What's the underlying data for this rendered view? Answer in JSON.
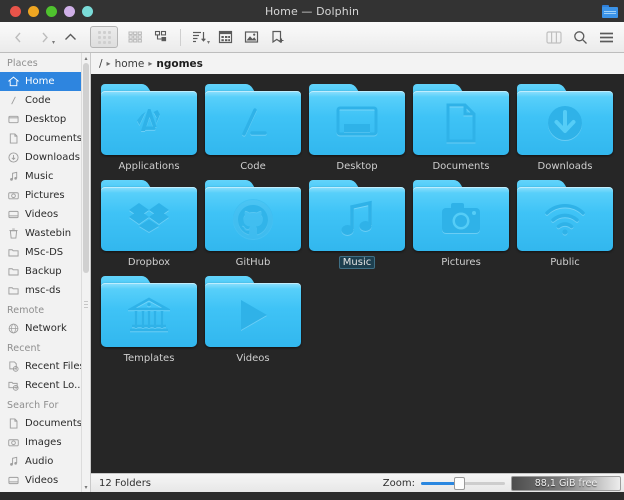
{
  "window": {
    "title": "Home — Dolphin",
    "traffic_lights": [
      "red",
      "yellow",
      "green",
      "purple",
      "cyan"
    ],
    "title_icon": "folder-icon"
  },
  "toolbar": {
    "items": [
      {
        "name": "back-button",
        "icon": "chevron-left-icon",
        "enabled": false
      },
      {
        "name": "forward-button",
        "icon": "chevron-right-icon",
        "enabled": false
      },
      {
        "name": "up-button",
        "icon": "chevron-up-icon",
        "enabled": true
      },
      {
        "name": "icons-view-button",
        "icon": "grid-view-icon",
        "enabled": true
      },
      {
        "name": "compact-view-button",
        "icon": "compact-view-icon",
        "enabled": true
      },
      {
        "name": "details-view-button",
        "icon": "details-view-icon",
        "enabled": true
      },
      {
        "name": "sort-button",
        "icon": "sort-icon",
        "enabled": true
      },
      {
        "name": "additional-info-button",
        "icon": "table-icon",
        "enabled": true
      },
      {
        "name": "preview-button",
        "icon": "image-preview-icon",
        "enabled": true
      },
      {
        "name": "split-new-button",
        "icon": "new-tab-icon",
        "enabled": true
      }
    ],
    "right_items": [
      {
        "name": "split-view-button",
        "icon": "split-panel-icon"
      },
      {
        "name": "search-button",
        "icon": "search-icon"
      },
      {
        "name": "menu-button",
        "icon": "hamburger-menu-icon"
      }
    ]
  },
  "sidebar": {
    "groups": [
      {
        "title": "Places",
        "items": [
          {
            "label": "Home",
            "icon": "home-icon",
            "active": true
          },
          {
            "label": "Code",
            "icon": "slash-icon",
            "active": false
          },
          {
            "label": "Desktop",
            "icon": "desktop-icon",
            "active": false
          },
          {
            "label": "Documents",
            "icon": "document-icon",
            "active": false
          },
          {
            "label": "Downloads",
            "icon": "download-icon",
            "active": false
          },
          {
            "label": "Music",
            "icon": "music-note-icon",
            "active": false
          },
          {
            "label": "Pictures",
            "icon": "camera-icon",
            "active": false
          },
          {
            "label": "Videos",
            "icon": "video-icon",
            "active": false
          },
          {
            "label": "Wastebin",
            "icon": "trash-icon",
            "active": false
          },
          {
            "label": "MSc-DS",
            "icon": "folder-icon",
            "active": false
          },
          {
            "label": "Backup",
            "icon": "folder-icon",
            "active": false
          },
          {
            "label": "msc-ds",
            "icon": "folder-icon",
            "active": false
          }
        ]
      },
      {
        "title": "Remote",
        "items": [
          {
            "label": "Network",
            "icon": "network-icon",
            "active": false
          }
        ]
      },
      {
        "title": "Recent",
        "items": [
          {
            "label": "Recent Files",
            "icon": "recent-file-icon",
            "active": false
          },
          {
            "label": "Recent Lo...",
            "icon": "recent-folder-icon",
            "active": false
          }
        ]
      },
      {
        "title": "Search For",
        "items": [
          {
            "label": "Documents",
            "icon": "document-icon",
            "active": false
          },
          {
            "label": "Images",
            "icon": "camera-icon",
            "active": false
          },
          {
            "label": "Audio",
            "icon": "music-note-icon",
            "active": false
          },
          {
            "label": "Videos",
            "icon": "video-icon",
            "active": false
          }
        ]
      }
    ]
  },
  "breadcrumb": {
    "root": "/",
    "separator": "▸",
    "parts": [
      "home",
      "ngomes"
    ]
  },
  "files": {
    "rows": [
      [
        {
          "name": "Applications",
          "icon": "applications-icon",
          "selected": false
        },
        {
          "name": "Code",
          "icon": "code-slash-icon",
          "selected": false
        },
        {
          "name": "Desktop",
          "icon": "desktop-icon",
          "selected": false
        },
        {
          "name": "Documents",
          "icon": "document-page-icon",
          "selected": false
        },
        {
          "name": "Downloads",
          "icon": "download-arrow-icon",
          "selected": false
        }
      ],
      [
        {
          "name": "Dropbox",
          "icon": "dropbox-icon",
          "selected": false
        },
        {
          "name": "GitHub",
          "icon": "github-octocat-icon",
          "selected": false
        },
        {
          "name": "Music",
          "icon": "music-note-icon",
          "selected": true
        },
        {
          "name": "Pictures",
          "icon": "camera-icon",
          "selected": false
        },
        {
          "name": "Public",
          "icon": "wifi-icon",
          "selected": false
        }
      ],
      [
        {
          "name": "Templates",
          "icon": "bank-columns-icon",
          "selected": false
        },
        {
          "name": "Videos",
          "icon": "play-triangle-icon",
          "selected": false
        }
      ]
    ]
  },
  "statusbar": {
    "count_text": "12 Folders",
    "zoom_label": "Zoom:",
    "zoom_value": 38,
    "free_space": "88,1 GiB free"
  },
  "colors": {
    "folder_light": "#5fd3fb",
    "folder_dark": "#32b7ee",
    "accent": "#2e85df",
    "view_bg": "#262626",
    "chrome_bg": "#f2f2f2",
    "titlebar_bg": "#333333"
  }
}
